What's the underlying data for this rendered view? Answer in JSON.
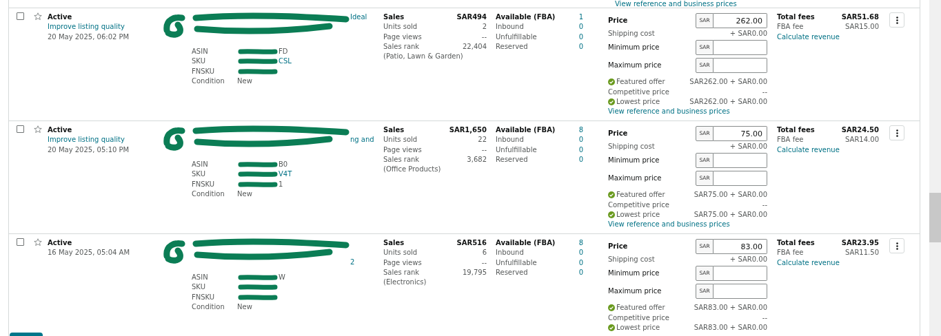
{
  "previous_row": {
    "link": "View reference and business prices"
  },
  "listings": [
    {
      "checked": false,
      "starred": false,
      "status": "Active",
      "quality_link": "Improve listing quality",
      "date": "20 May 2025, 06:02 PM",
      "title_fragment": "Ideal",
      "details": [
        {
          "label": "ASIN",
          "value": "FD",
          "redacted": true,
          "link": false
        },
        {
          "label": "SKU",
          "value": "CSL",
          "redacted": true,
          "link": true
        },
        {
          "label": "FNSKU",
          "redacted": true
        },
        {
          "label": "Condition",
          "value": "New",
          "link": false
        }
      ],
      "sales": {
        "label": "Sales",
        "value": "SAR494",
        "units_label": "Units sold",
        "units": "2",
        "views_label": "Page views",
        "views": "--",
        "rank_label": "Sales rank",
        "rank": "22,404",
        "category": "(Patio, Lawn & Garden)"
      },
      "inventory": [
        {
          "label": "Available (FBA)",
          "value": "1"
        },
        {
          "label": "Inbound",
          "value": "0"
        },
        {
          "label": "Unfulfillable",
          "value": "0"
        },
        {
          "label": "Reserved",
          "value": "0"
        }
      ],
      "pricing": {
        "price_label": "Price",
        "currency": "SAR",
        "min_currency": "SAR",
        "max_currency": "SAR",
        "price": "262.00",
        "shipping_label": "Shipping cost",
        "shipping": "+ SAR0.00",
        "min_label": "Minimum price",
        "max_label": "Maximum price",
        "offers": [
          {
            "label": "Featured offer",
            "value": "SAR262.00 + SAR0.00",
            "ok": true
          },
          {
            "label": "Competitive price",
            "value": "--",
            "ok": false
          },
          {
            "label": "Lowest price",
            "value": "SAR262.00 + SAR0.00",
            "ok": true
          }
        ],
        "link": "View reference and business prices"
      },
      "fees": {
        "total_label": "Total fees",
        "total": "SAR51.68",
        "fba_label": "FBA fee",
        "fba": "SAR15.00",
        "link": "Calculate revenue"
      }
    },
    {
      "checked": false,
      "starred": false,
      "status": "Active",
      "quality_link": "Improve listing quality",
      "date": "20 May 2025, 05:10 PM",
      "title_fragment": "ng and",
      "details": [
        {
          "label": "ASIN",
          "value": "B0",
          "redacted": true,
          "link": false
        },
        {
          "label": "SKU",
          "value": "V4T",
          "redacted": true,
          "link": true
        },
        {
          "label": "FNSKU",
          "value": "1",
          "redacted": true,
          "link": false
        },
        {
          "label": "Condition",
          "value": "New",
          "link": false
        }
      ],
      "sales": {
        "label": "Sales",
        "value": "SAR1,650",
        "units_label": "Units sold",
        "units": "22",
        "views_label": "Page views",
        "views": "--",
        "rank_label": "Sales rank",
        "rank": "3,682",
        "category": "(Office Products)"
      },
      "inventory": [
        {
          "label": "Available (FBA)",
          "value": "8"
        },
        {
          "label": "Inbound",
          "value": "0"
        },
        {
          "label": "Unfulfillable",
          "value": "0"
        },
        {
          "label": "Reserved",
          "value": "0"
        }
      ],
      "pricing": {
        "price_label": "Price",
        "currency": "SAR",
        "min_currency": "SAR",
        "max_currency": "SAR",
        "price": "75.00",
        "shipping_label": "Shipping cost",
        "shipping": "+ SAR0.00",
        "min_label": "Minimum price",
        "max_label": "Maximum price",
        "offers": [
          {
            "label": "Featured offer",
            "value": "SAR75.00 + SAR0.00",
            "ok": true
          },
          {
            "label": "Competitive price",
            "value": "--",
            "ok": false
          },
          {
            "label": "Lowest price",
            "value": "SAR75.00 + SAR0.00",
            "ok": true
          }
        ],
        "link": "View reference and business prices"
      },
      "fees": {
        "total_label": "Total fees",
        "total": "SAR24.50",
        "fba_label": "FBA fee",
        "fba": "SAR14.00",
        "link": "Calculate revenue"
      }
    },
    {
      "checked": false,
      "starred": false,
      "status": "Active",
      "date": "16 May 2025, 05:04 AM",
      "title_fragment": "2",
      "details": [
        {
          "label": "ASIN",
          "value": "W",
          "redacted": true,
          "link": false
        },
        {
          "label": "SKU",
          "redacted": true
        },
        {
          "label": "FNSKU",
          "redacted": true
        },
        {
          "label": "Condition",
          "value": "New",
          "link": false
        }
      ],
      "sales": {
        "label": "Sales",
        "value": "SAR516",
        "units_label": "Units sold",
        "units": "6",
        "views_label": "Page views",
        "views": "--",
        "rank_label": "Sales rank",
        "rank": "19,795",
        "category": "(Electronics)"
      },
      "inventory": [
        {
          "label": "Available (FBA)",
          "value": "8"
        },
        {
          "label": "Inbound",
          "value": "0"
        },
        {
          "label": "Unfulfillable",
          "value": "0"
        },
        {
          "label": "Reserved",
          "value": "0"
        }
      ],
      "pricing": {
        "price_label": "Price",
        "currency": "SAR",
        "min_currency": "SAR",
        "max_currency": "SAR",
        "price": "83.00",
        "shipping_label": "Shipping cost",
        "shipping": "+ SAR0.00",
        "min_label": "Minimum price",
        "max_label": "Maximum price",
        "offers": [
          {
            "label": "Featured offer",
            "value": "SAR83.00 + SAR0.00",
            "ok": true
          },
          {
            "label": "Competitive price",
            "value": "--",
            "ok": false
          },
          {
            "label": "Lowest price",
            "value": "SAR83.00 + SAR0.00",
            "ok": true
          }
        ]
      },
      "fees": {
        "total_label": "Total fees",
        "total": "SAR23.95",
        "fba_label": "FBA fee",
        "fba": "SAR11.50",
        "link": "Calculate revenue"
      }
    }
  ]
}
